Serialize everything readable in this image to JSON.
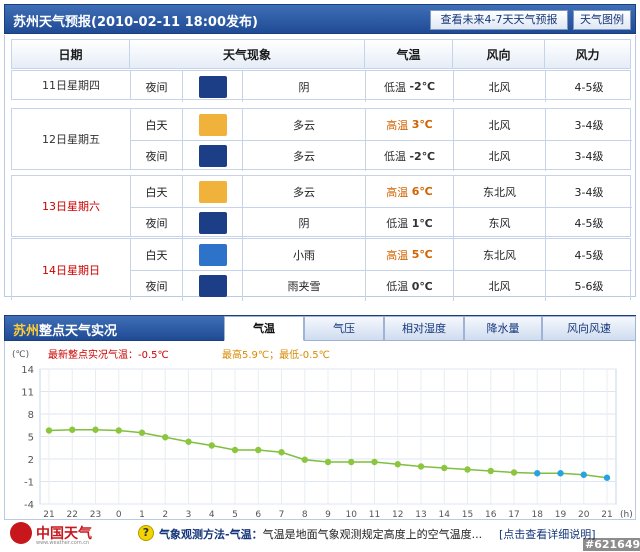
{
  "forecast": {
    "title": "苏州天气预报(2010-02-11  18:00发布)",
    "btn_47": "查看未来4-7天天气预报",
    "btn_map": "天气图例",
    "columns": [
      "日期",
      "天气现象",
      "气温",
      "风向",
      "风力"
    ],
    "days": [
      {
        "date": "11日星期四",
        "date_color": "#333333",
        "rows": [
          {
            "period": "夜间",
            "icon": "cloudy-night-icon",
            "desc": "阴",
            "temp_prefix": "低温",
            "temp": "-2℃",
            "wind": "北风",
            "force": "4-5级"
          }
        ]
      },
      {
        "date": "12日星期五",
        "date_color": "#333333",
        "rows": [
          {
            "period": "白天",
            "icon": "partly-cloudy-day-icon",
            "desc": "多云",
            "temp_prefix": "高温",
            "temp": "3℃",
            "wind": "北风",
            "force": "3-4级"
          },
          {
            "period": "夜间",
            "icon": "partly-cloudy-night-icon",
            "desc": "多云",
            "temp_prefix": "低温",
            "temp": "-2℃",
            "wind": "北风",
            "force": "3-4级"
          }
        ]
      },
      {
        "date": "13日星期六",
        "date_color": "#cc0000",
        "rows": [
          {
            "period": "白天",
            "icon": "partly-cloudy-day-icon",
            "desc": "多云",
            "temp_prefix": "高温",
            "temp": "6℃",
            "wind": "东北风",
            "force": "3-4级"
          },
          {
            "period": "夜间",
            "icon": "cloudy-night-icon",
            "desc": "阴",
            "temp_prefix": "低温",
            "temp": "1℃",
            "wind": "东风",
            "force": "4-5级"
          }
        ]
      },
      {
        "date": "14日星期日",
        "date_color": "#cc0000",
        "rows": [
          {
            "period": "白天",
            "icon": "light-rain-icon",
            "desc": "小雨",
            "temp_prefix": "高温",
            "temp": "5℃",
            "wind": "东北风",
            "force": "4-5级"
          },
          {
            "period": "夜间",
            "icon": "sleet-icon",
            "desc": "雨夹雪",
            "temp_prefix": "低温",
            "temp": "0℃",
            "wind": "北风",
            "force": "5-6级"
          }
        ]
      }
    ]
  },
  "observation": {
    "title_city": "苏州",
    "title_rest": "整点天气实况",
    "tabs": [
      "气温",
      "气压",
      "相对湿度",
      "降水量",
      "风向风速"
    ],
    "active_tab": 0
  },
  "chart_data": {
    "type": "line",
    "unit_label": "(℃)",
    "x_unit_label": "(h)",
    "latest_label": "最新整点实况气温：-0.5℃",
    "maxmin_label": "最高5.9℃；最低-0.5℃",
    "x": [
      "21",
      "22",
      "23",
      "0",
      "1",
      "2",
      "3",
      "4",
      "5",
      "6",
      "7",
      "8",
      "9",
      "10",
      "11",
      "12",
      "13",
      "14",
      "15",
      "16",
      "17",
      "18",
      "19",
      "20",
      "21"
    ],
    "values": [
      5.8,
      5.9,
      5.9,
      5.8,
      5.5,
      4.9,
      4.3,
      3.8,
      3.2,
      3.2,
      2.9,
      1.9,
      1.6,
      1.6,
      1.6,
      1.3,
      1.0,
      0.8,
      0.6,
      0.4,
      0.2,
      0.1,
      0.1,
      -0.1,
      -0.5
    ],
    "y_ticks": [
      14,
      11,
      8,
      5,
      2,
      -1,
      -4
    ],
    "ylim": [
      -4,
      14
    ],
    "line_color": "#7fbf3f",
    "point_color": "#8cc63f",
    "recent_point_color": "#29a3e0",
    "recent_from_index": 21,
    "grid": true
  },
  "footer": {
    "logo_text": "中国天气",
    "logo_url": "www.weather.com.cn",
    "method_label": "气象观测方法-气温：",
    "method_text": "气温是地面气象观测规定高度上的空气温度...",
    "detail_link": "[点击查看详细说明]",
    "watermark": "#621649"
  }
}
